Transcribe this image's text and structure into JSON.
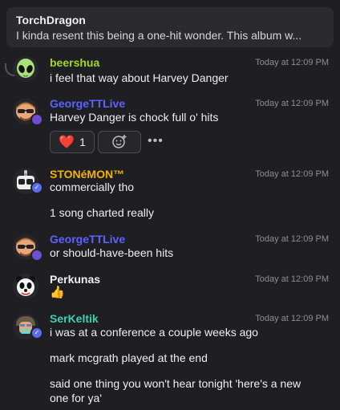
{
  "reply_banner": {
    "username": "TorchDragon",
    "text": "I kinda resent this being a one-hit wonder. This album w..."
  },
  "messages": [
    {
      "username": "beershua",
      "time": "Today at 12:09 PM",
      "lines": [
        "i feel that way about Harvey Danger"
      ],
      "avatar": "alien-avatar"
    },
    {
      "username": "GeorgeTTLive",
      "time": "Today at 12:09 PM",
      "lines": [
        "Harvey Danger is chock full o' hits"
      ],
      "avatar": "sunglasses-man-avatar",
      "reactions": [
        {
          "emoji": "❤️",
          "count": "1"
        }
      ]
    },
    {
      "username": "STONéMON™",
      "time": "Today at 12:09 PM",
      "lines": [
        "commercially tho",
        "1 song charted really"
      ],
      "avatar": "robot-avatar"
    },
    {
      "username": "GeorgeTTLive",
      "time": "Today at 12:09 PM",
      "lines": [
        "or should-have-been hits"
      ],
      "avatar": "sunglasses-man-avatar"
    },
    {
      "username": "Perkunas",
      "time": "Today at 12:09 PM",
      "lines": [
        "👍"
      ],
      "avatar": "panda-avatar"
    },
    {
      "username": "SerKeltik",
      "time": "Today at 12:09 PM",
      "lines": [
        "i was at a conference a couple weeks ago",
        "mark mcgrath played at the end",
        "said one thing you won't hear tonight 'here's a new",
        "one for ya'"
      ],
      "avatar": "helmet-avatar"
    }
  ],
  "reaction_more": "•••",
  "colors": {
    "background": "#1f1f23",
    "beershua": "#a3d81e",
    "GeorgeTTLive": "#5b63ff",
    "STONéMON™": "#f0b400",
    "SerKeltik": "#3fd0b0"
  }
}
